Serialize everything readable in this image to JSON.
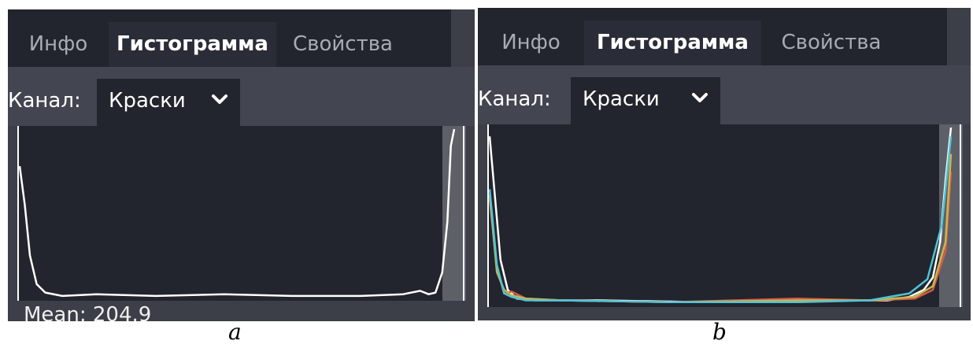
{
  "panels": [
    {
      "tabs": [
        {
          "label": "Инфо",
          "active": false
        },
        {
          "label": "Гистограмма",
          "active": true
        },
        {
          "label": "Свойства",
          "active": false
        }
      ],
      "channel": {
        "label": "Канал:",
        "value": "Краски"
      },
      "stats_partial": "Mean: 204.9"
    },
    {
      "tabs": [
        {
          "label": "Инфо",
          "active": false
        },
        {
          "label": "Гистограмма",
          "active": true
        },
        {
          "label": "Свойства",
          "active": false
        }
      ],
      "channel": {
        "label": "Канал:",
        "value": "Краски"
      }
    }
  ],
  "captions": {
    "a": "a",
    "b": "b"
  },
  "colors": {
    "histogram_bg": "#22252e",
    "panel_bg": "#3c3f48",
    "luminosity": "#ffffff",
    "red": "#d65a4a",
    "green": "#c8b84a",
    "cyan": "#4fc3d8"
  },
  "chart_data": [
    {
      "type": "line",
      "channel": "Краски",
      "x_range": [
        0,
        255
      ],
      "series": [
        {
          "color": "#ffffff",
          "x": [
            0,
            3,
            6,
            10,
            15,
            25,
            45,
            80,
            120,
            160,
            200,
            225,
            235,
            240,
            244,
            248,
            251,
            253,
            255
          ],
          "y": [
            78,
            55,
            25,
            8,
            3,
            1,
            2,
            1,
            2,
            1,
            1,
            2,
            4,
            2,
            3,
            15,
            45,
            90,
            100
          ]
        }
      ]
    },
    {
      "type": "line",
      "channel": "Краски",
      "x_range": [
        0,
        255
      ],
      "series": [
        {
          "color": "#ffffff",
          "x": [
            0,
            3,
            6,
            10,
            15,
            25,
            60,
            120,
            180,
            220,
            232,
            240,
            245,
            249,
            252,
            255
          ],
          "y": [
            95,
            60,
            25,
            8,
            3,
            2,
            2,
            1,
            2,
            2,
            4,
            8,
            15,
            35,
            70,
            100
          ]
        },
        {
          "color": "#d65a4a",
          "x": [
            0,
            4,
            8,
            12,
            20,
            40,
            100,
            170,
            210,
            235,
            245,
            252,
            255
          ],
          "y": [
            60,
            20,
            6,
            7,
            3,
            2,
            1,
            3,
            2,
            3,
            8,
            30,
            75
          ]
        },
        {
          "color": "#c8b84a",
          "x": [
            0,
            4,
            8,
            12,
            20,
            40,
            100,
            170,
            210,
            235,
            245,
            252,
            255
          ],
          "y": [
            62,
            18,
            8,
            5,
            3,
            2,
            1,
            2,
            2,
            4,
            10,
            35,
            85
          ]
        },
        {
          "color": "#4fc3d8",
          "x": [
            0,
            4,
            8,
            12,
            20,
            40,
            100,
            170,
            210,
            232,
            242,
            250,
            255
          ],
          "y": [
            65,
            22,
            6,
            4,
            2,
            2,
            1,
            1,
            2,
            6,
            14,
            45,
            95
          ]
        }
      ]
    }
  ]
}
